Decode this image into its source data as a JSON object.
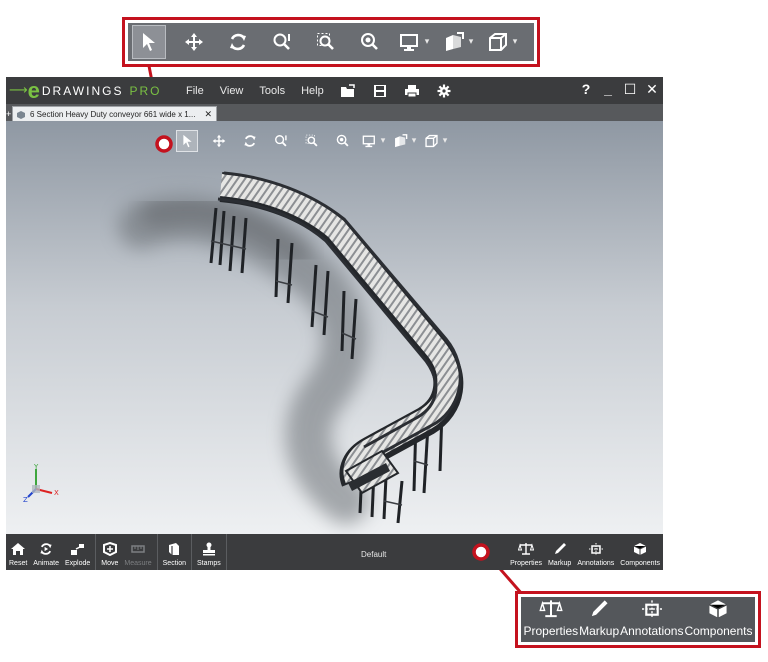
{
  "app": {
    "logo_word": "DRAWINGS",
    "logo_pro": "PRO",
    "menus": [
      "File",
      "View",
      "Tools",
      "Help"
    ],
    "help_glyph": "?",
    "window_controls": [
      "_",
      "☐",
      "✕"
    ],
    "tab_title": "6 Section Heavy Duty conveyor 661 wide x 1...",
    "tab_close": "✕",
    "configuration": "Default"
  },
  "view_toolbar": {
    "icons": [
      "select-arrow-icon",
      "pan-icon",
      "rotate-icon",
      "zoom-to-fit-icon",
      "zoom-to-area-icon",
      "zoom-icon",
      "display-style-icon",
      "view-orientation-icon",
      "cube-icon"
    ],
    "caret": "▾"
  },
  "bottom_toolbar": {
    "left": [
      "Reset",
      "Animate",
      "Explode",
      "Move",
      "Measure",
      "Section",
      "Stamps"
    ],
    "right": [
      "Properties",
      "Markup",
      "Annotations",
      "Components"
    ]
  },
  "callout_bottom": {
    "labels": [
      "Properties",
      "Markup",
      "Annotations",
      "Components"
    ]
  },
  "colors": {
    "callout_border": "#c4121e",
    "brand_green": "#7ac143",
    "toolbar_gray": "#6a6d72"
  }
}
